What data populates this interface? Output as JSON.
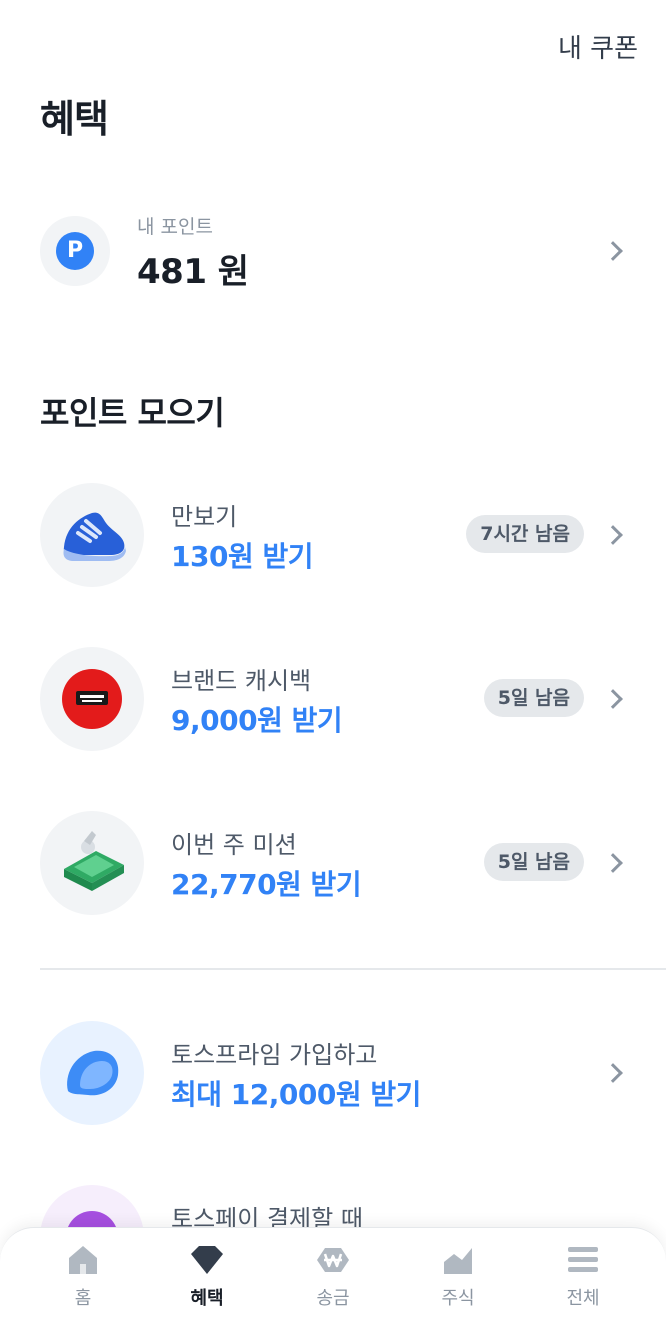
{
  "header": {
    "coupon_link": "내 쿠폰",
    "title": "혜택"
  },
  "points": {
    "label": "내 포인트",
    "value": "481 원",
    "badge": "P"
  },
  "collect": {
    "title": "포인트 모으기",
    "items": [
      {
        "title": "만보기",
        "reward": "130원 받기",
        "badge": "7시간 남음",
        "icon": "shoe-icon"
      },
      {
        "title": "브랜드 캐시백",
        "reward": "9,000원 받기",
        "badge": "5일 남음",
        "icon": "pascucci-logo"
      },
      {
        "title": "이번 주 미션",
        "reward": "22,770원 받기",
        "badge": "5일 남음",
        "icon": "cash-stack-icon"
      }
    ]
  },
  "promos": [
    {
      "title": "토스프라임 가입하고",
      "reward": "최대 12,000원 받기",
      "icon": "toss-prime-icon"
    },
    {
      "title": "토스페이 결제할 때",
      "icon": "toss-pay-icon"
    }
  ],
  "nav": [
    {
      "label": "홈",
      "icon": "home-icon",
      "active": false
    },
    {
      "label": "혜택",
      "icon": "benefit-gem-icon",
      "active": true
    },
    {
      "label": "송금",
      "icon": "won-transfer-icon",
      "active": false
    },
    {
      "label": "주식",
      "icon": "stock-chart-icon",
      "active": false
    },
    {
      "label": "전체",
      "icon": "menu-icon",
      "active": false
    }
  ],
  "colors": {
    "accent": "#3182f6",
    "text": "#191f28",
    "subtext": "#4e5968",
    "muted": "#8b95a1",
    "pill_bg": "#e5e8eb",
    "circle_bg": "#f2f4f6"
  }
}
